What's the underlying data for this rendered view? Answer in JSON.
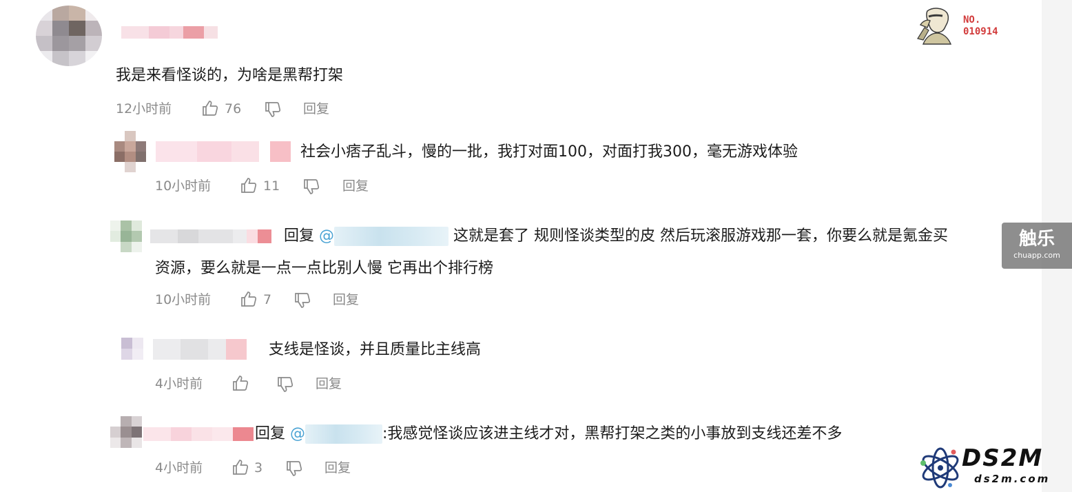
{
  "badge": {
    "line1": "NO.",
    "line2": "010914"
  },
  "watermarks": {
    "chuapp_logo": "触乐",
    "chuapp_url": "chuapp.com",
    "ds2m_logo": "DS2M",
    "ds2m_url": "ds2m.com"
  },
  "comments": [
    {
      "text": "我是来看怪谈的，为啥是黑帮打架",
      "time": "12小时前",
      "likes": "76",
      "reply": "回复"
    },
    {
      "text": "社会小痞子乱斗，慢的一批，我打对面100，对面打我300，毫无游戏体验",
      "time": "10小时前",
      "likes": "11",
      "reply": "回复"
    },
    {
      "prefix": "回复",
      "at": "@",
      "text1": "这就是套了 规则怪谈类型的皮 然后玩滚服游戏那一套，你要么就是氪金买",
      "text2": "资源，要么就是一点一点比别人慢 它再出个排行榜",
      "time": "10小时前",
      "likes": "7",
      "reply": "回复"
    },
    {
      "text": "支线是怪谈，并且质量比主线高",
      "time": "4小时前",
      "likes": "",
      "reply": "回复"
    },
    {
      "prefix": "回复",
      "at": "@",
      "text": ":我感觉怪谈应该进主线才对，黑帮打架之类的小事放到支线还差不多",
      "time": "4小时前",
      "likes": "3",
      "reply": "回复"
    }
  ],
  "colors": {
    "text": "#1c1c1c",
    "meta": "#8a8a8a",
    "mention": "#4aa3d4"
  }
}
